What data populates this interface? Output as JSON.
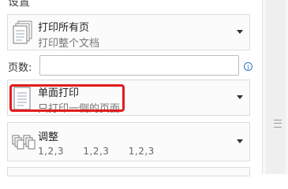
{
  "settings": {
    "section_title": "设置",
    "print_range": {
      "title": "打印所有页",
      "subtitle": "打印整个文档",
      "icon": "document-stack-icon"
    },
    "pages": {
      "label": "页数:",
      "value": "",
      "placeholder": "",
      "info_icon": "info-icon"
    },
    "sides": {
      "title": "单面打印",
      "subtitle": "只打印一侧的页面",
      "icon": "single-page-icon"
    },
    "collation": {
      "title": "调整",
      "icon": "collate-icon",
      "sequence": [
        "1,2,3",
        "1,2,3",
        "1,2,3"
      ]
    }
  }
}
